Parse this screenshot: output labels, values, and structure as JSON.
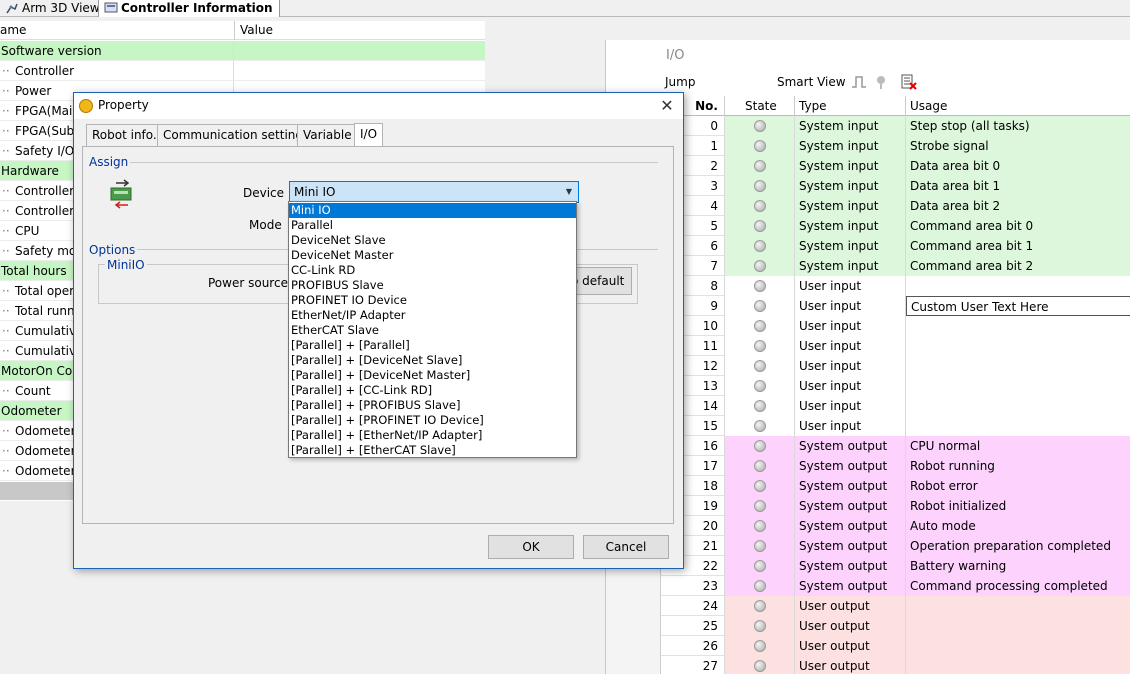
{
  "doc_tabs": [
    {
      "label": "Arm 3D View",
      "active": false
    },
    {
      "label": "Controller Information",
      "active": true
    }
  ],
  "left_panel": {
    "headers": {
      "name": "ame",
      "value": "Value"
    },
    "rows": [
      {
        "label": "Software version",
        "cat": true
      },
      {
        "label": "Controller",
        "cat": false
      },
      {
        "label": "Power",
        "cat": false
      },
      {
        "label": "FPGA(Main)",
        "cat": false
      },
      {
        "label": "FPGA(Sub)",
        "cat": false
      },
      {
        "label": "Safety I/O",
        "cat": false
      },
      {
        "label": "Hardware",
        "cat": true
      },
      {
        "label": "Controller I",
        "cat": false
      },
      {
        "label": "Controller t",
        "cat": false
      },
      {
        "label": "CPU",
        "cat": false
      },
      {
        "label": "Safety mot",
        "cat": false
      },
      {
        "label": "Total hours",
        "cat": true
      },
      {
        "label": "Total opera",
        "cat": false
      },
      {
        "label": "Total runni",
        "cat": false
      },
      {
        "label": "Cumulative",
        "cat": false
      },
      {
        "label": "Cumulative",
        "cat": false
      },
      {
        "label": "MotorOn Cou",
        "cat": true
      },
      {
        "label": "Count",
        "cat": false
      },
      {
        "label": "Odometer",
        "cat": true
      },
      {
        "label": "Odometer",
        "cat": false
      },
      {
        "label": "Odometer",
        "cat": false
      },
      {
        "label": "Odometer",
        "cat": false
      }
    ]
  },
  "io_window": {
    "title": "I/O",
    "toolbar": {
      "jump": "Jump",
      "smart_view": "Smart View"
    },
    "headers": {
      "no": "No.",
      "state": "State",
      "type": "Type",
      "usage": "Usage"
    },
    "rows": [
      {
        "no": "0",
        "type": "System input",
        "usage": "Step stop (all tasks)",
        "group": "si"
      },
      {
        "no": "1",
        "type": "System input",
        "usage": "Strobe signal",
        "group": "si"
      },
      {
        "no": "2",
        "type": "System input",
        "usage": "Data area bit 0",
        "group": "si"
      },
      {
        "no": "3",
        "type": "System input",
        "usage": "Data area bit 1",
        "group": "si"
      },
      {
        "no": "4",
        "type": "System input",
        "usage": "Data area bit 2",
        "group": "si"
      },
      {
        "no": "5",
        "type": "System input",
        "usage": "Command area  bit 0",
        "group": "si"
      },
      {
        "no": "6",
        "type": "System input",
        "usage": "Command area  bit 1",
        "group": "si"
      },
      {
        "no": "7",
        "type": "System input",
        "usage": "Command area  bit 2",
        "group": "si"
      },
      {
        "no": "8",
        "type": "User input",
        "usage": "",
        "group": "ui"
      },
      {
        "no": "9",
        "type": "User input",
        "usage": "Custom User Text Here",
        "group": "ui",
        "editing": true
      },
      {
        "no": "10",
        "type": "User input",
        "usage": "",
        "group": "ui"
      },
      {
        "no": "11",
        "type": "User input",
        "usage": "",
        "group": "ui"
      },
      {
        "no": "12",
        "type": "User input",
        "usage": "",
        "group": "ui"
      },
      {
        "no": "13",
        "type": "User input",
        "usage": "",
        "group": "ui"
      },
      {
        "no": "14",
        "type": "User input",
        "usage": "",
        "group": "ui"
      },
      {
        "no": "15",
        "type": "User input",
        "usage": "",
        "group": "ui"
      },
      {
        "no": "16",
        "type": "System output",
        "usage": "CPU normal",
        "group": "so"
      },
      {
        "no": "17",
        "type": "System output",
        "usage": "Robot running",
        "group": "so"
      },
      {
        "no": "18",
        "type": "System output",
        "usage": "Robot error",
        "group": "so"
      },
      {
        "no": "19",
        "type": "System output",
        "usage": "Robot initialized",
        "group": "so"
      },
      {
        "no": "20",
        "type": "System output",
        "usage": "Auto mode",
        "group": "so"
      },
      {
        "no": "21",
        "type": "System output",
        "usage": "Operation preparation completed",
        "group": "so"
      },
      {
        "no": "22",
        "type": "System output",
        "usage": "Battery warning",
        "group": "so"
      },
      {
        "no": "23",
        "type": "System output",
        "usage": "Command processing completed",
        "group": "so"
      },
      {
        "no": "24",
        "type": "User output",
        "usage": "",
        "group": "uo"
      },
      {
        "no": "25",
        "type": "User output",
        "usage": "",
        "group": "uo"
      },
      {
        "no": "26",
        "type": "User output",
        "usage": "",
        "group": "uo"
      },
      {
        "no": "27",
        "type": "User output",
        "usage": "",
        "group": "uo"
      }
    ]
  },
  "dialog": {
    "title": "Property",
    "close_glyph": "✕",
    "tabs": [
      {
        "label": "Robot info.",
        "active": false
      },
      {
        "label": "Communication setting",
        "active": false
      },
      {
        "label": "Variable",
        "active": false
      },
      {
        "label": "I/O",
        "active": true
      }
    ],
    "assign_label": "Assign",
    "device_label": "Device",
    "device_value": "Mini IO",
    "mode_label": "Mode",
    "options_label": "Options",
    "minio_label": "MiniIO",
    "power_source_label": "Power source:",
    "default_button": "o default",
    "ok_button": "OK",
    "cancel_button": "Cancel",
    "device_options": [
      "Mini IO",
      "Parallel",
      "DeviceNet Slave",
      "DeviceNet Master",
      "CC-Link RD",
      "PROFIBUS Slave",
      "PROFINET IO Device",
      "EtherNet/IP Adapter",
      "EtherCAT Slave",
      "[Parallel] + [Parallel]",
      "[Parallel] + [DeviceNet Slave]",
      "[Parallel] + [DeviceNet Master]",
      "[Parallel] + [CC-Link RD]",
      "[Parallel] + [PROFIBUS Slave]",
      "[Parallel] + [PROFINET IO Device]",
      "[Parallel] + [EtherNet/IP Adapter]",
      "[Parallel] + [EtherCAT Slave]"
    ],
    "selected_option": 0
  },
  "colors": {
    "category_green": "#c6f6c4",
    "system_input": "#dcf7dc",
    "system_output": "#fdd3fd",
    "user_output": "#fde0e0",
    "selection_blue": "#0078d7"
  }
}
